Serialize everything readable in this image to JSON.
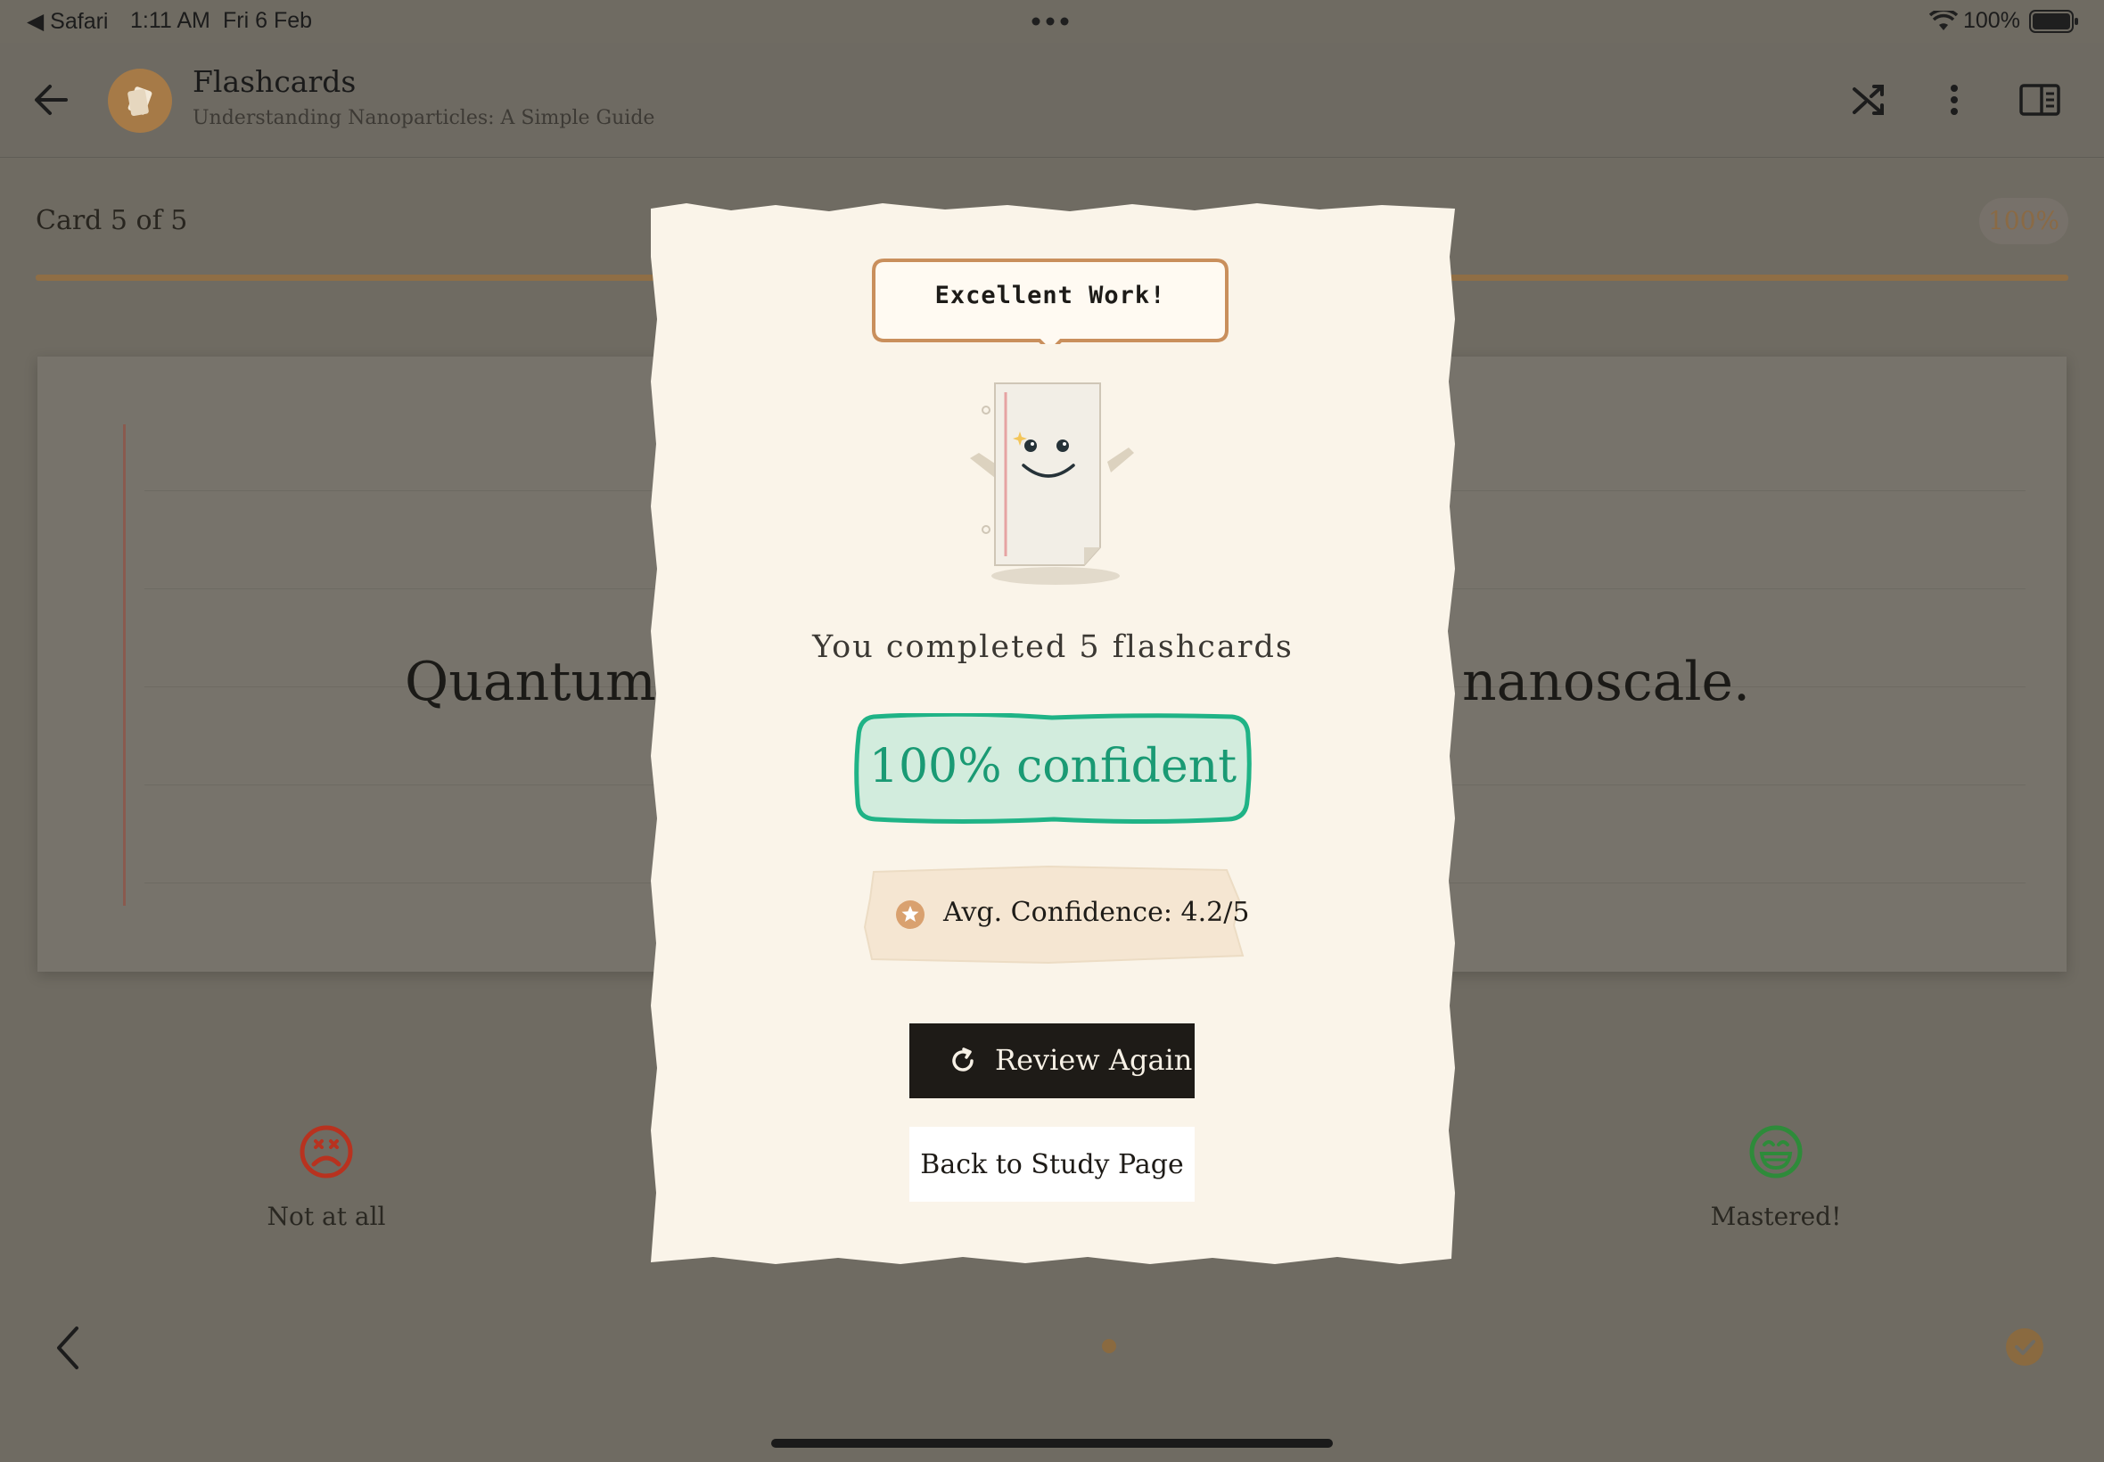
{
  "status_bar": {
    "back_app": "◀ Safari",
    "time": "1:11 AM",
    "date": "Fri 6 Feb",
    "battery": "100%"
  },
  "header": {
    "title": "Flashcards",
    "subtitle": "Understanding Nanoparticles: A Simple Guide"
  },
  "study": {
    "card_counter": "Card 5 of 5",
    "progress_percent": "100%",
    "progress_fraction": 1.0,
    "card_text_left": "Quantum r",
    "card_text_right": "nanoscale.",
    "ratings": [
      {
        "label": "Not at all",
        "icon": "frown-face-icon",
        "color": "#c0301f"
      },
      {
        "label": "Mastered!",
        "icon": "grinning-face-icon",
        "color": "#2e8b3a"
      }
    ]
  },
  "modal": {
    "bubble_text": "Excellent Work!",
    "completed_text": "You completed 5 flashcards",
    "confidence_badge": "100% confident",
    "avg_confidence": "Avg. Confidence: 4.2/5",
    "review_button": "Review Again",
    "back_button": "Back to Study Page"
  },
  "colors": {
    "accent": "#b07a42",
    "success": "#1a9a74",
    "paper": "#faf4e9",
    "dark": "#1e1b17"
  }
}
